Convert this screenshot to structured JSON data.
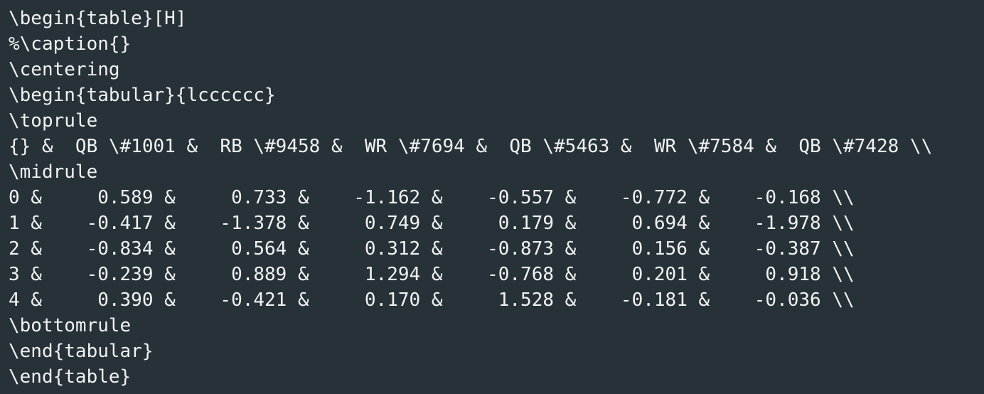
{
  "editor": {
    "background": "#263238",
    "text_color": "#f2f2f2",
    "lines": [
      "\\begin{table}[H]",
      "%\\caption{}",
      "\\centering",
      "\\begin{tabular}{lcccccc}",
      "\\toprule",
      "{} &  QB \\#1001 &  RB \\#9458 &  WR \\#7694 &  QB \\#5463 &  WR \\#7584 &  QB \\#7428 \\\\",
      "\\midrule",
      "0 &     0.589 &     0.733 &    -1.162 &    -0.557 &    -0.772 &    -0.168 \\\\",
      "1 &    -0.417 &    -1.378 &     0.749 &     0.179 &     0.694 &    -1.978 \\\\",
      "2 &    -0.834 &     0.564 &     0.312 &    -0.873 &     0.156 &    -0.387 \\\\",
      "3 &    -0.239 &     0.889 &     1.294 &    -0.768 &     0.201 &     0.918 \\\\",
      "4 &     0.390 &    -0.421 &     0.170 &     1.528 &    -0.181 &    -0.036 \\\\",
      "\\bottomrule",
      "\\end{tabular}",
      "\\end{table}"
    ]
  }
}
